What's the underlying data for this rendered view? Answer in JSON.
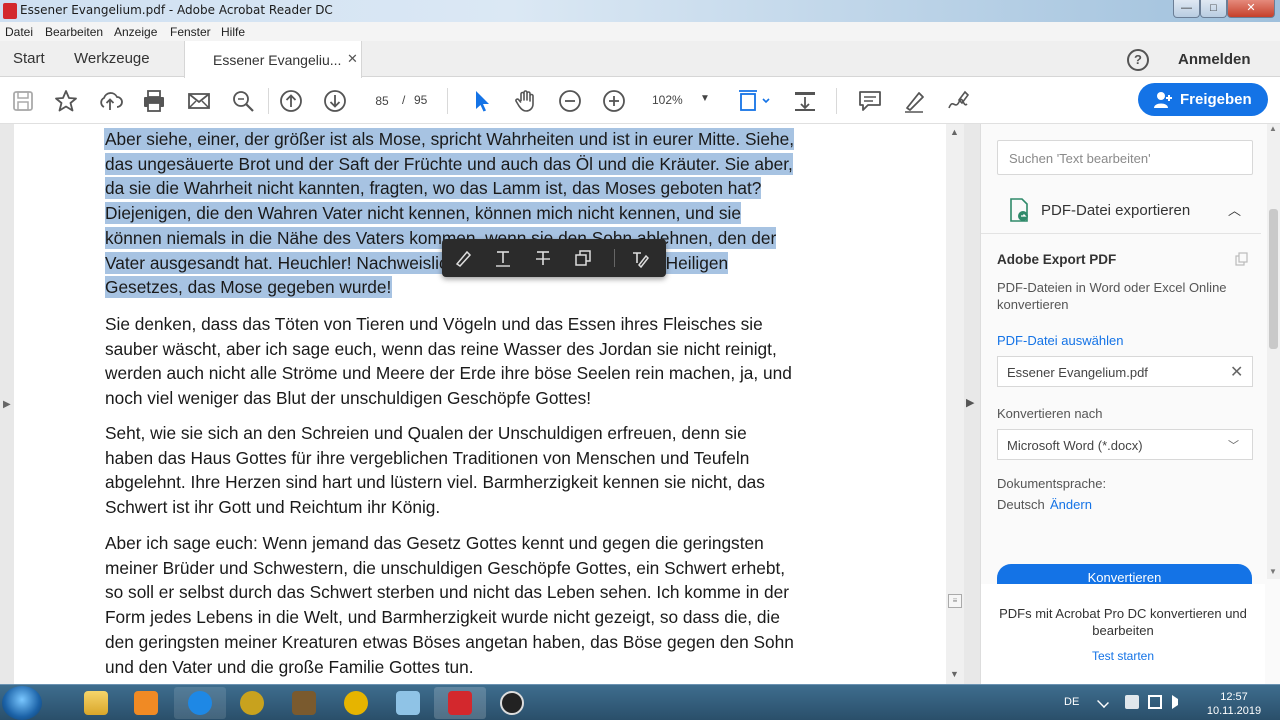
{
  "window": {
    "title": "Essener Evangelium.pdf - Adobe Acrobat Reader DC",
    "controls": {
      "minimize": "—",
      "maximize": "□",
      "close": "✕"
    }
  },
  "menu": [
    "Datei",
    "Bearbeiten",
    "Anzeige",
    "Fenster",
    "Hilfe"
  ],
  "tabs": {
    "start": "Start",
    "tools": "Werkzeuge",
    "document": "Essener Evangeliu...",
    "close_glyph": "✕"
  },
  "header_right": {
    "help": "?",
    "signin": "Anmelden"
  },
  "toolbar": {
    "current_page": "85",
    "page_separator": "/",
    "total_pages": "95",
    "zoom": "102%",
    "zoom_caret": "▼",
    "share_label": "Freigeben"
  },
  "document": {
    "paragraphs": [
      "Aber siehe, einer, der größer ist als Mose, spricht Wahrheiten und ist in eurer Mitte. Siehe,\ndas ungesäuerte Brot und der Saft der Früchte und auch das Öl und die Kräuter. Sie aber,\nda sie die Wahrheit nicht kannten, fragten, wo das Lamm ist, das Moses geboten hat?\nDiejenigen, die den Wahren Vater nicht kennen, können mich nicht kennen, und sie\nkönnen niemals in die Nähe des Vaters kommen, wenn sie den Sohn ablehnen, den der\nVater ausgesandt hat. Heuchler! Nachweislich seid ihr die Übertreter des Heiligen\nGesetzes, das Mose gegeben wurde!",
      "Sie denken, dass das Töten von Tieren und Vögeln und das Essen ihres Fleisches sie\nsauber wäscht, aber ich sage euch, wenn das reine Wasser des Jordan sie nicht reinigt,\nwerden auch nicht alle Ströme und Meere der Erde ihre böse Seelen rein machen, ja, und\nnoch viel weniger das Blut der unschuldigen Geschöpfe Gottes!",
      "Seht, wie sie sich an den Schreien und Qualen der Unschuldigen erfreuen, denn sie\nhaben das Haus Gottes für ihre vergeblichen Traditionen von Menschen und Teufeln\nabgelehnt. Ihre Herzen sind hart und lüstern viel. Barmherzigkeit kennen sie nicht, das\nSchwert ist ihr Gott und Reichtum ihr König.",
      "Aber ich sage euch: Wenn jemand das Gesetz Gottes kennt und gegen die geringsten\nmeiner Brüder und Schwestern, die unschuldigen Geschöpfe Gottes, ein Schwert erhebt,\nso soll er selbst durch das Schwert sterben und nicht das Leben sehen. Ich komme in der\nForm jedes Lebens in die Welt, und Barmherzigkeit wurde nicht gezeigt, so dass die, die\nden geringsten meiner Kreaturen etwas Böses angetan haben, das Böse gegen den Sohn\nund den Vater und die große Familie Gottes tun."
    ],
    "selected_paragraph": 0
  },
  "right_panel": {
    "search_placeholder": "Suchen 'Text bearbeiten'",
    "export_header": "PDF-Datei exportieren",
    "export_title": "Adobe Export PDF",
    "export_desc": "PDF-Dateien in Word oder Excel Online konvertieren",
    "choose_file": "PDF-Datei auswählen",
    "file_value": "Essener Evangelium.pdf",
    "convert_to_label": "Konvertieren nach",
    "format_value": "Microsoft Word (*.docx)",
    "doc_language_label": "Dokumentsprache:",
    "doc_language_value": "Deutsch",
    "change_language": "Ändern",
    "convert_button": "Konvertieren",
    "promo_text": "PDFs mit Acrobat Pro DC konvertieren und bearbeiten",
    "trial_link": "Test starten"
  },
  "taskbar": {
    "language": "DE",
    "time": "12:57",
    "date": "10.11.2019"
  },
  "colors": {
    "accent": "#1473e6",
    "selection": "#a7c3e2",
    "acrobat_red": "#d3282d"
  }
}
